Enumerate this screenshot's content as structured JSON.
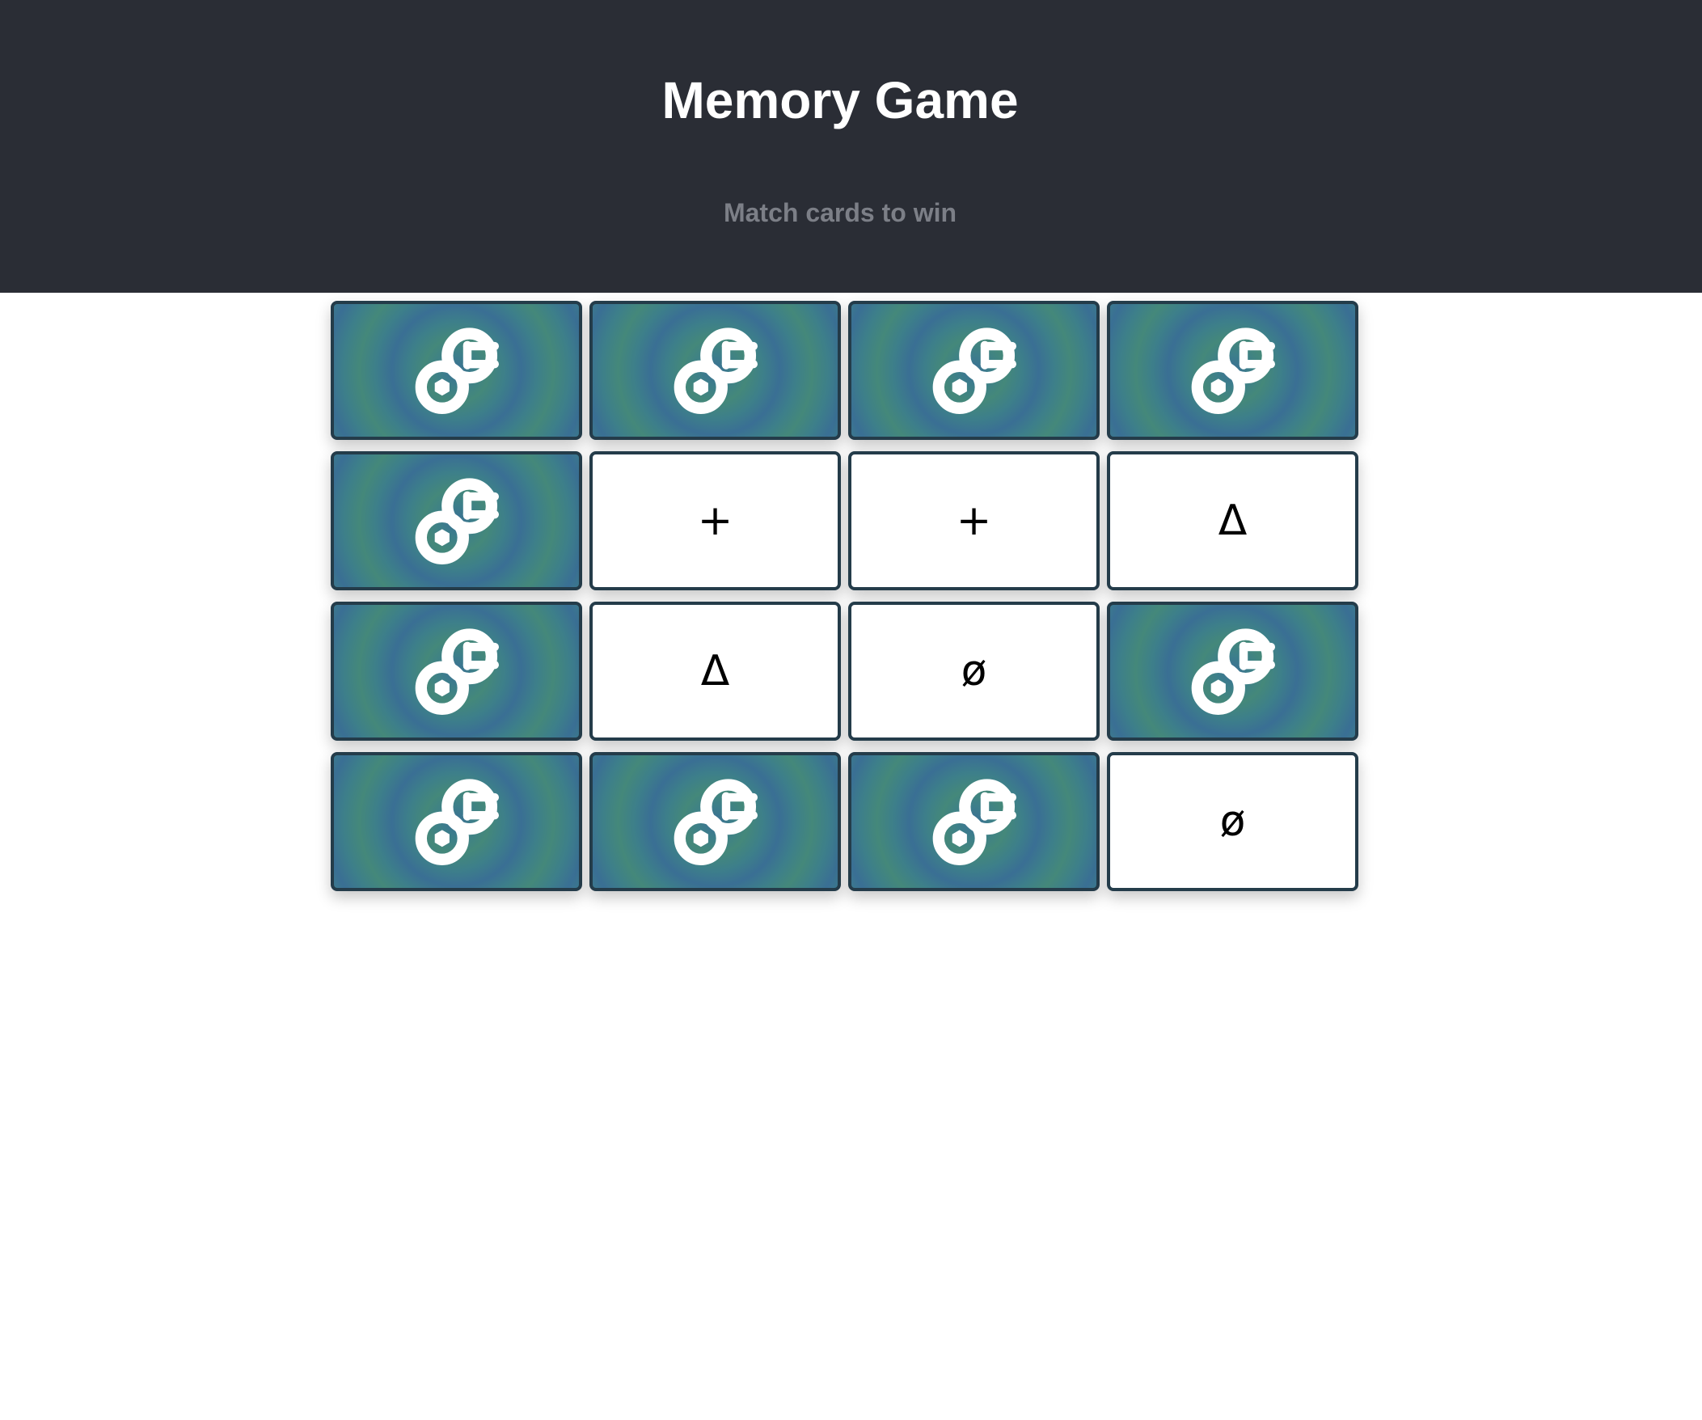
{
  "header": {
    "title": "Memory Game",
    "subtitle": "Match cards to win"
  },
  "colors": {
    "header_bg": "#2a2d35",
    "title": "#ffffff",
    "subtitle": "#7c7f87",
    "card_border": "#243c4a",
    "card_back_blue": "#3a6f94",
    "card_back_green": "#44887a",
    "card_face": "#ffffff"
  },
  "card_back_icon": "link-logo-icon",
  "board": {
    "rows": 4,
    "columns": 4,
    "cards": [
      {
        "state": "hidden",
        "symbol": ""
      },
      {
        "state": "hidden",
        "symbol": ""
      },
      {
        "state": "hidden",
        "symbol": ""
      },
      {
        "state": "hidden",
        "symbol": ""
      },
      {
        "state": "hidden",
        "symbol": ""
      },
      {
        "state": "revealed",
        "symbol": "+"
      },
      {
        "state": "revealed",
        "symbol": "+"
      },
      {
        "state": "revealed",
        "symbol": "Δ"
      },
      {
        "state": "hidden",
        "symbol": ""
      },
      {
        "state": "revealed",
        "symbol": "Δ"
      },
      {
        "state": "revealed",
        "symbol": "ø"
      },
      {
        "state": "hidden",
        "symbol": ""
      },
      {
        "state": "hidden",
        "symbol": ""
      },
      {
        "state": "hidden",
        "symbol": ""
      },
      {
        "state": "hidden",
        "symbol": ""
      },
      {
        "state": "revealed",
        "symbol": "ø"
      }
    ]
  }
}
